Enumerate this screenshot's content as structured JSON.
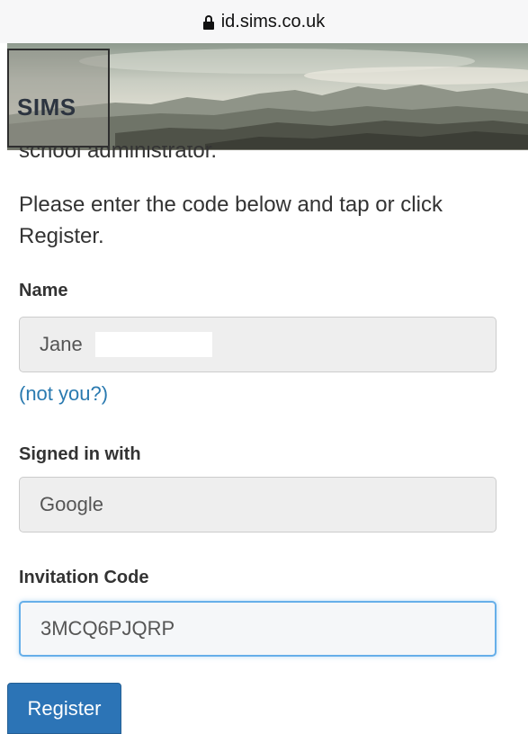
{
  "browser": {
    "url": "id.sims.co.uk"
  },
  "header": {
    "logo_text": "SIMS"
  },
  "content": {
    "clipped_text": "school administrator.",
    "instruction": "Please enter the code below and tap or click Register."
  },
  "form": {
    "name": {
      "label": "Name",
      "value": "Jane"
    },
    "not_you_link": "(not you?)",
    "signed_in_with": {
      "label": "Signed in with",
      "value": "Google"
    },
    "invitation_code": {
      "label": "Invitation Code",
      "value": "3MCQ6PJQRP"
    },
    "register_label": "Register"
  },
  "colors": {
    "link": "#2a7ab0",
    "primary_button": "#2c74b6",
    "readonly_field_bg": "#eeeeee",
    "focus_border": "#66afe9"
  }
}
